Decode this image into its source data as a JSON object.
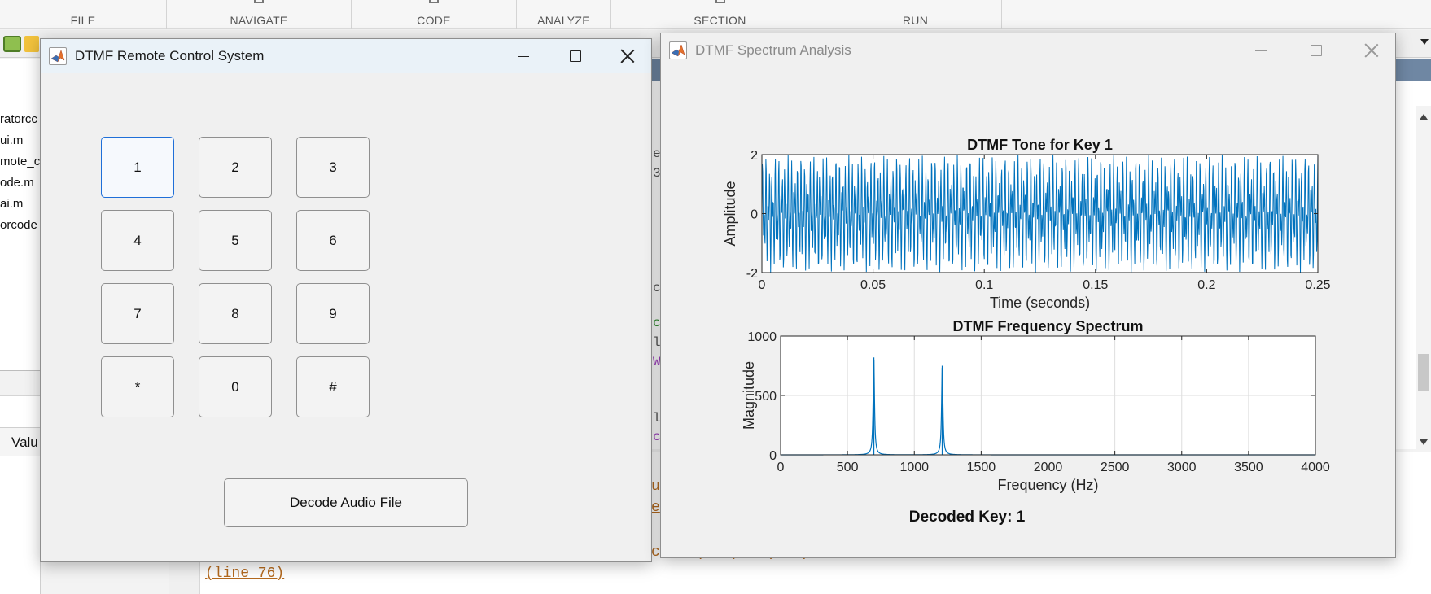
{
  "ide": {
    "tabs": [
      "FILE",
      "NAVIGATE",
      "CODE",
      "ANALYZE",
      "SECTION",
      "RUN"
    ],
    "files": [
      "ratorcc",
      "ui.m",
      "mote_c",
      "ode.m",
      "ai.m",
      "orcode"
    ],
    "workspace_header": "Valu",
    "editor_fragments": [
      "ec",
      "3]",
      "c",
      "cc",
      "li",
      "Wa",
      "l",
      "cy"
    ],
    "cmd_fragments": [
      "u",
      "e"
    ],
    "error_line": "ccm..(...)...(...)...........................c",
    "error_location": "(line 76)"
  },
  "keypad_window": {
    "title": "DTMF Remote Control System",
    "keys": [
      "1",
      "2",
      "3",
      "4",
      "5",
      "6",
      "7",
      "8",
      "9",
      "*",
      "0",
      "#"
    ],
    "decode_label": "Decode Audio File"
  },
  "spectrum_window": {
    "title": "DTMF Spectrum Analysis",
    "decoded_label": "Decoded Key: 1"
  },
  "chart_data": [
    {
      "type": "line",
      "title": "DTMF Tone for Key 1",
      "xlabel": "Time (seconds)",
      "ylabel": "Amplitude",
      "xlim": [
        0,
        0.25
      ],
      "ylim": [
        -2,
        2
      ],
      "xticks": [
        "0",
        "0.05",
        "0.1",
        "0.15",
        "0.2",
        "0.25"
      ],
      "yticks": [
        "2",
        "0",
        "-2"
      ],
      "grid": false,
      "color": "#0072bd",
      "series": [
        {
          "signal": "sin(2*pi*697*t) + sin(2*pi*1209*t)",
          "freqs_hz": [
            697,
            1209
          ],
          "amplitude_peak": 2
        }
      ]
    },
    {
      "type": "line",
      "title": "DTMF Frequency Spectrum",
      "xlabel": "Frequency (Hz)",
      "ylabel": "Magnitude",
      "xlim": [
        0,
        4000
      ],
      "ylim": [
        0,
        1000
      ],
      "xticks": [
        "0",
        "500",
        "1000",
        "1500",
        "2000",
        "2500",
        "3000",
        "3500",
        "4000"
      ],
      "yticks": [
        "1000",
        "500",
        "0"
      ],
      "grid": true,
      "color": "#0072bd",
      "series": [
        {
          "peaks": [
            {
              "freq_hz": 697,
              "magnitude": 820
            },
            {
              "freq_hz": 1209,
              "magnitude": 750
            }
          ]
        }
      ]
    }
  ]
}
